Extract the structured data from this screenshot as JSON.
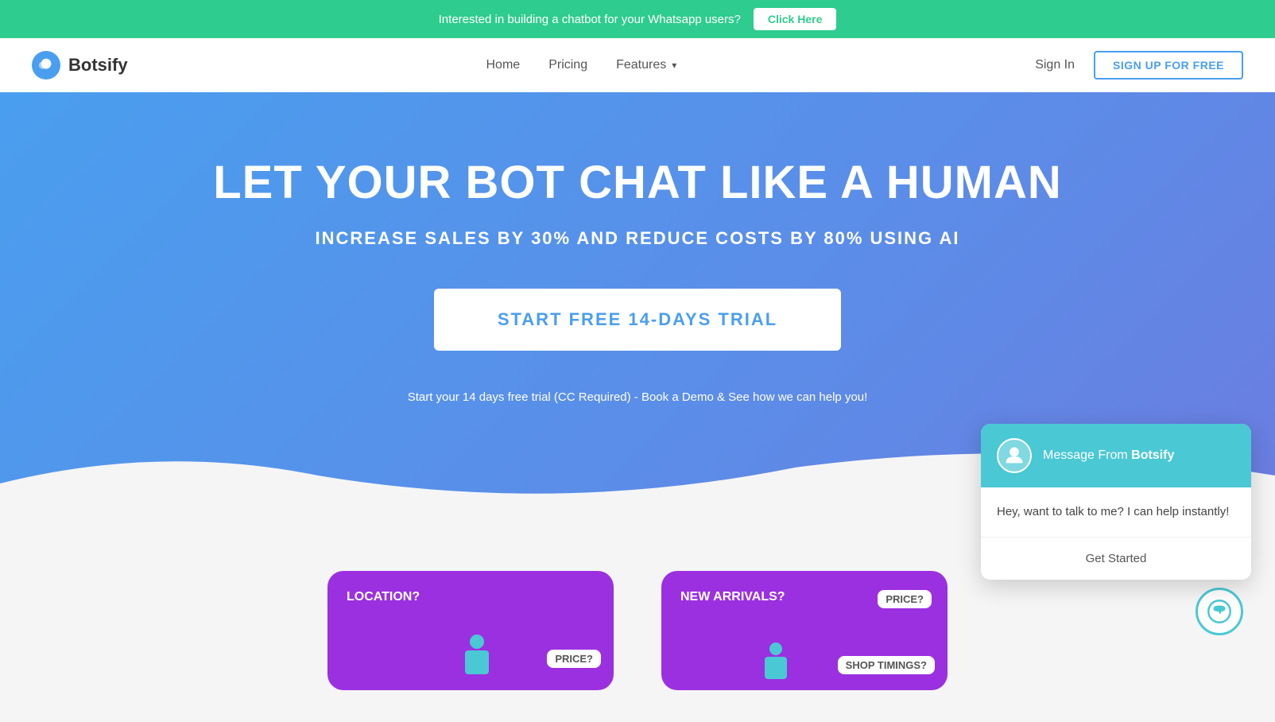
{
  "banner": {
    "text": "Interested in building a chatbot for your Whatsapp users?",
    "button_label": "Click Here"
  },
  "navbar": {
    "logo_text": "Botsify",
    "links": [
      {
        "label": "Home",
        "has_dropdown": false
      },
      {
        "label": "Pricing",
        "has_dropdown": false
      },
      {
        "label": "Features",
        "has_dropdown": true
      }
    ],
    "sign_in_label": "Sign In",
    "signup_label": "SIGN UP FOR FREE"
  },
  "hero": {
    "headline": "LET YOUR BOT CHAT LIKE A HUMAN",
    "subheadline": "INCREASE SALES BY 30% AND REDUCE COSTS BY 80% USING AI",
    "trial_button": "START FREE 14-DAYS TRIAL",
    "subtext": "Start your 14 days free trial (CC Required) - Book a Demo & See how we can help you!"
  },
  "cards": [
    {
      "texts": [
        "LOCATION?",
        "PRICE?"
      ],
      "id": "card-left"
    },
    {
      "texts": [
        "NEW ARRIVALS?",
        "PRICE?",
        "SHOP TIMINGS?"
      ],
      "id": "card-right"
    }
  ],
  "chat_popup": {
    "header_text": "Message From ",
    "header_brand": "Botsify",
    "body_text": "Hey, want to talk to me? I can help instantly!",
    "footer_text": "Get Started"
  }
}
